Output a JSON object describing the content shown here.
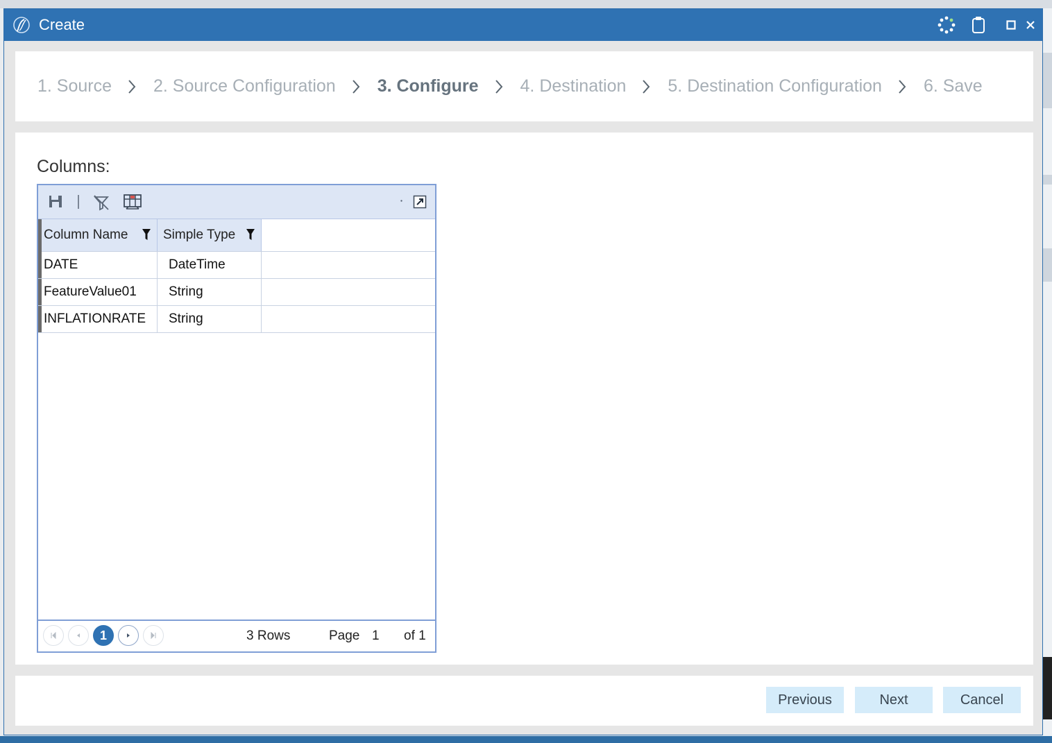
{
  "window": {
    "title": "Create"
  },
  "wizard": {
    "steps": [
      {
        "label": "1. Source",
        "active": false
      },
      {
        "label": "2. Source Configuration",
        "active": false
      },
      {
        "label": "3. Configure",
        "active": true
      },
      {
        "label": "4. Destination",
        "active": false
      },
      {
        "label": "5. Destination Configuration",
        "active": false
      },
      {
        "label": "6. Save",
        "active": false
      }
    ]
  },
  "columns_section": {
    "label": "Columns:",
    "grid": {
      "headers": [
        "Column Name",
        "Simple Type"
      ],
      "rows": [
        [
          "DATE",
          "DateTime"
        ],
        [
          "FeatureValue01",
          "String"
        ],
        [
          "INFLATIONRATE",
          "String"
        ]
      ],
      "pager": {
        "current_page_button": "1",
        "rows_text": "3 Rows",
        "page_label": "Page",
        "page_value": "1",
        "of_text": "of 1"
      }
    }
  },
  "footer": {
    "previous_label": "Previous",
    "next_label": "Next",
    "cancel_label": "Cancel"
  },
  "icons": {
    "title": [
      "app-logo-icon",
      "busy-spinner-icon",
      "clipboard-icon",
      "maximize-icon",
      "close-icon"
    ],
    "grid_toolbar": [
      "save-icon",
      "clear-filter-icon",
      "column-chooser-icon",
      "expand-icon"
    ]
  },
  "colors": {
    "titlebar": "#2f72b3",
    "accent": "#2f72b3",
    "grid_header": "#dde6f5",
    "button_bg": "#d5ecfa"
  }
}
